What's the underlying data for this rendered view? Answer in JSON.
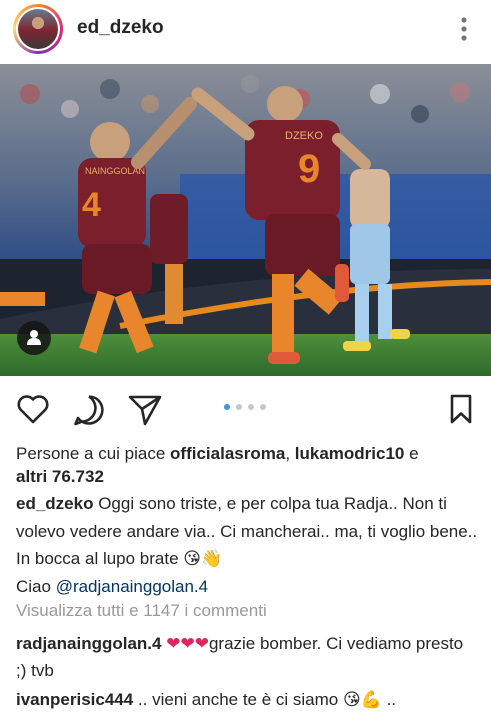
{
  "header": {
    "username": "ed_dzeko"
  },
  "post": {
    "shirt_name": "DZEKO",
    "shirt_number": "9",
    "teammate_name": "NAINGGOLAN",
    "teammate_number": "4",
    "carousel": {
      "count": 4,
      "active": 1
    }
  },
  "likes": {
    "prefix": "Persone a cui piace ",
    "user1": "officialasroma",
    "separator": ", ",
    "user2": "lukamodric10",
    "conjunction": " e",
    "others": "altri 76.732"
  },
  "caption": {
    "username": "ed_dzeko",
    "text": " Oggi sono triste, e per colpa tua Radja.. Non ti volevo vedere andare via.. Ci mancherai.. ma, ti voglio bene.. In bocca al lupo brate 😘👋",
    "line2_prefix": "Ciao ",
    "mention": "@radjanainggolan.4"
  },
  "view_all_comments": "Visualizza tutti e 1147 i commenti",
  "comments": [
    {
      "username": "radjanainggolan.4",
      "text_pre": " ",
      "hearts": "❤❤❤",
      "text_post": "grazie bomber. Ci vediamo presto ;) tvb"
    },
    {
      "username": "ivanperisic444",
      "text": " .. vieni anche te è ci siamo 😘💪 .."
    }
  ],
  "colors": {
    "roma_shirt": "#7a1f2b",
    "roma_orange": "#e9862b",
    "lazio_blue": "#9ec7e8",
    "pitch": "#3f7f34",
    "accent_blue": "#3897f0"
  },
  "icons": {
    "more": "more-vertical-icon",
    "like": "heart-outline-icon",
    "comment": "speech-bubble-icon",
    "share": "paper-plane-icon",
    "save": "bookmark-icon",
    "user_tag": "user-silhouette-icon"
  }
}
